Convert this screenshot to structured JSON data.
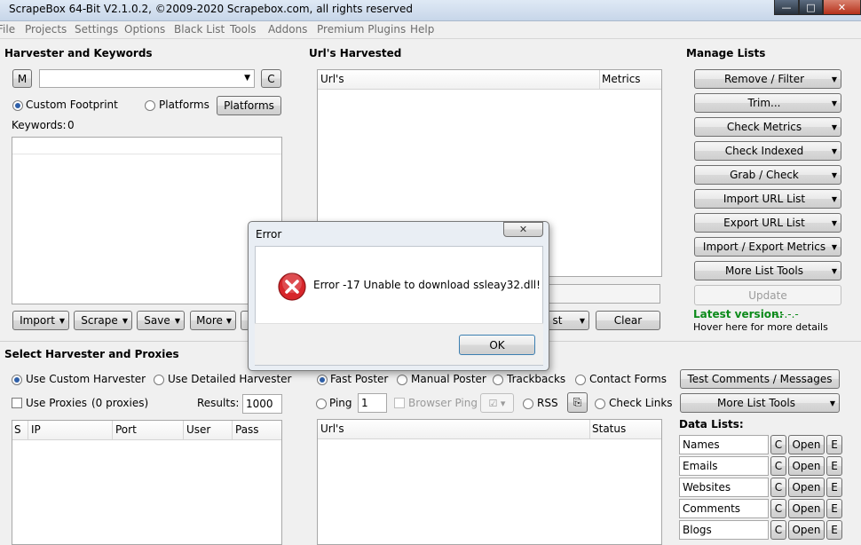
{
  "window": {
    "title": "ScrapeBox 64-Bit V2.1.0.2, ©2009-2020 Scrapebox.com, all rights reserved",
    "minimize_glyph": "—",
    "maximize_glyph": "□",
    "close_glyph": "✕"
  },
  "menu": [
    "File",
    "Projects",
    "Settings",
    "Options",
    "Black List",
    "Tools",
    "Addons",
    "Premium Plugins",
    "Help"
  ],
  "harvester": {
    "title": "Harvester and Keywords",
    "m_label": "M",
    "c_label": "C",
    "custom_footprint": "Custom Footprint",
    "platforms_radio": "Platforms",
    "platforms_button": "Platforms",
    "keywords_label": "Keywords:",
    "keywords_count": "0",
    "buttons": [
      "Import",
      "Scrape",
      "Save",
      "More"
    ]
  },
  "urls": {
    "title": "Url's Harvested",
    "col_url": "Url's",
    "col_metrics": "Metrics",
    "partial_button": "st",
    "clear": "Clear"
  },
  "manage": {
    "title": "Manage Lists",
    "buttons": [
      "Remove / Filter",
      "Trim...",
      "Check Metrics",
      "Check Indexed",
      "Grab / Check",
      "Import URL List",
      "Export URL List",
      "Import / Export Metrics",
      "More List Tools"
    ],
    "update": "Update",
    "latest_label": "Latest version:",
    "latest_value": "-.-.-.-",
    "hover": "Hover here for more details"
  },
  "proxies": {
    "title": "Select Harvester and Proxies",
    "use_custom": "Use Custom Harvester",
    "use_detailed": "Use Detailed Harvester",
    "use_proxies": "Use Proxies",
    "proxy_count": "(0 proxies)",
    "results_label": "Results:",
    "results_value": "1000",
    "cols": [
      "S",
      "IP",
      "Port",
      "User",
      "Pass"
    ]
  },
  "poster": {
    "fast": "Fast Poster",
    "manual": "Manual Poster",
    "trackbacks": "Trackbacks",
    "contact": "Contact Forms",
    "ping": "Ping",
    "ping_value": "1",
    "browser_ping": "Browser Ping",
    "rss": "RSS",
    "check_links": "Check Links",
    "col_url": "Url's",
    "col_status": "Status"
  },
  "right2": {
    "test_comments": "Test Comments / Messages",
    "more_tools": "More List Tools",
    "data_lists_label": "Data Lists:",
    "lists": [
      "Names",
      "Emails",
      "Websites",
      "Comments",
      "Blogs"
    ],
    "c_label": "C",
    "open_label": "Open",
    "e_label": "E"
  },
  "dialog": {
    "title": "Error",
    "close_glyph": "✕",
    "message": "Error -17 Unable to download ssleay32.dll!",
    "ok": "OK"
  },
  "colors": {
    "latest_green": "#0c8a1a",
    "error_red": "#d7262b"
  }
}
